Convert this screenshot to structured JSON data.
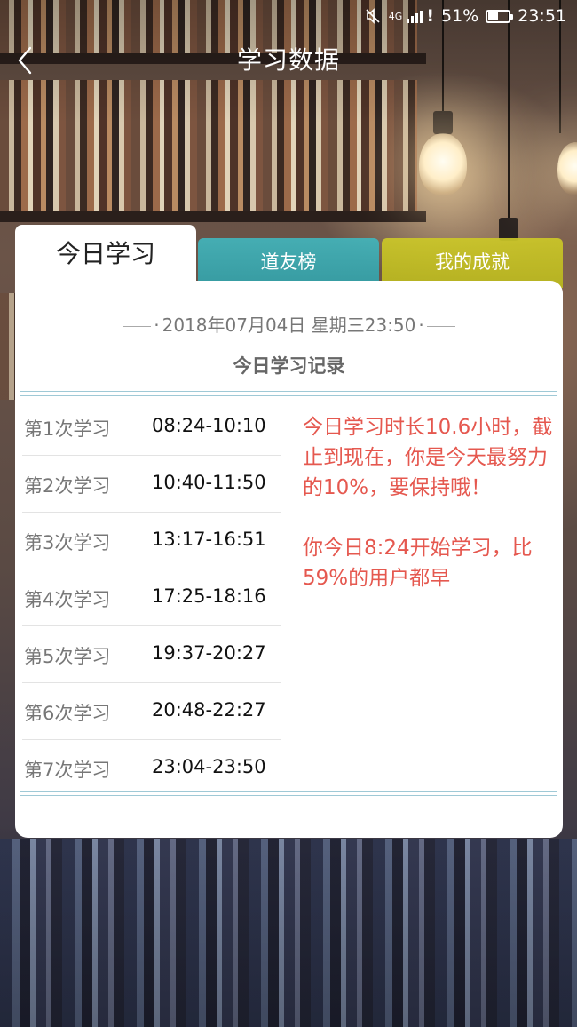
{
  "status_bar": {
    "network": "4G",
    "battery_percent": "51%",
    "battery_level": 0.51,
    "time": "23:51"
  },
  "header": {
    "title": "学习数据"
  },
  "tabs": [
    {
      "label": "今日学习",
      "active": true
    },
    {
      "label": "道友榜",
      "active": false
    },
    {
      "label": "我的成就",
      "active": false
    }
  ],
  "card": {
    "date": "2018年07月04日 星期三23:50",
    "record_title": "今日学习记录",
    "sessions": [
      {
        "label": "第1次学习",
        "time": "08:24-10:10"
      },
      {
        "label": "第2次学习",
        "time": "10:40-11:50"
      },
      {
        "label": "第3次学习",
        "time": "13:17-16:51"
      },
      {
        "label": "第4次学习",
        "time": "17:25-18:16"
      },
      {
        "label": "第5次学习",
        "time": "19:37-20:27"
      },
      {
        "label": "第6次学习",
        "time": "20:48-22:27"
      },
      {
        "label": "第7次学习",
        "time": "23:04-23:50"
      }
    ],
    "summary": [
      "今日学习时长10.6小时，截止到现在，你是今天最努力的10%，要保持哦！",
      "你今日8:24开始学习，比59%的用户都早"
    ]
  },
  "colors": {
    "friends_tab": "#3fb2b9",
    "achievement_tab": "#c9c72a",
    "summary_text": "#e5584f",
    "rule": "#9fc9d6"
  }
}
